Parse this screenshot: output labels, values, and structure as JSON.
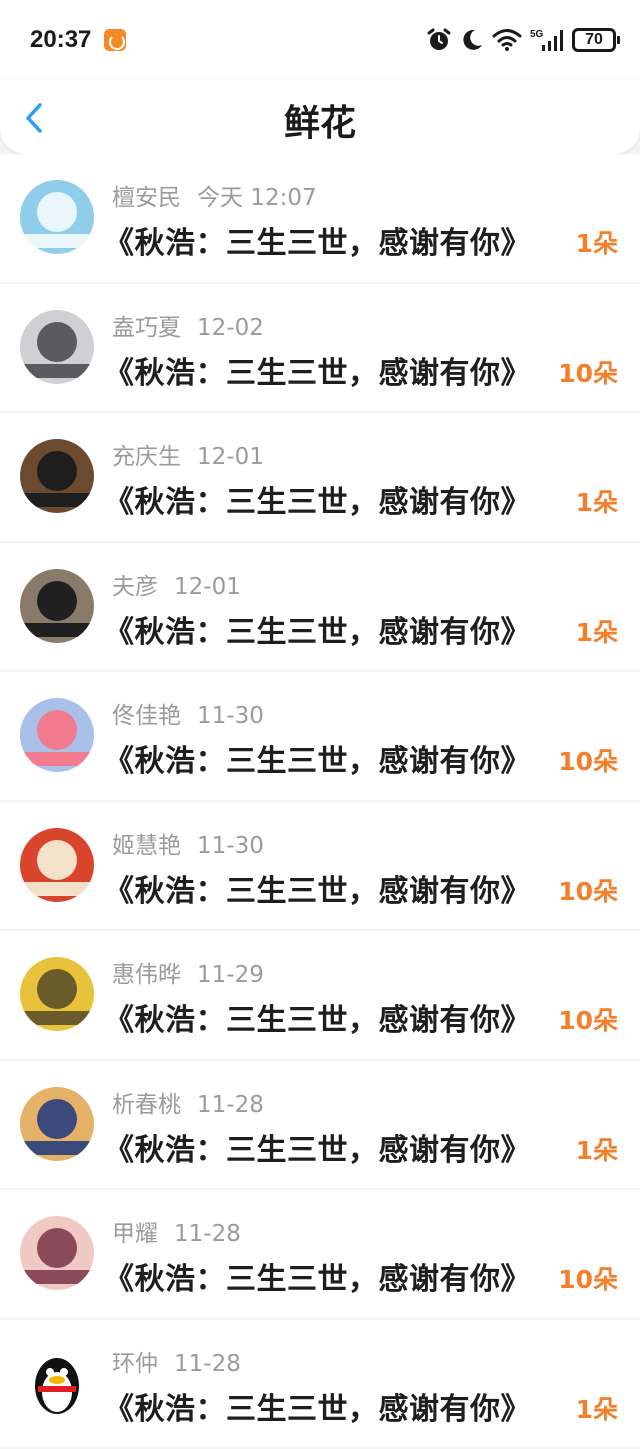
{
  "status_bar": {
    "time": "20:37",
    "network": "5G",
    "battery": "70",
    "icons": [
      "app-notification-icon",
      "alarm-icon",
      "moon-icon",
      "wifi-icon",
      "signal-icon",
      "battery-icon"
    ]
  },
  "header": {
    "title": "鲜花",
    "back_icon": "chevron-left-icon"
  },
  "colors": {
    "accent": "#2b9cf2",
    "count": "#f47e2a",
    "meta": "#9b9b9b",
    "title": "#1e1e1e"
  },
  "items": [
    {
      "name": "檀安民",
      "date": "今天 12:07",
      "title": "《秋浩：三生三世，感谢有你》",
      "count": "1朵",
      "avatar_bg": "#8fcdea",
      "avatar_fg": "#e9f6fc"
    },
    {
      "name": "盍巧夏",
      "date": "12-02",
      "title": "《秋浩：三生三世，感谢有你》",
      "count": "10朵",
      "avatar_bg": "#cfcfd4",
      "avatar_fg": "#5a5a5f"
    },
    {
      "name": "充庆生",
      "date": "12-01",
      "title": "《秋浩：三生三世，感谢有你》",
      "count": "1朵",
      "avatar_bg": "#6b4a2f",
      "avatar_fg": "#1e1e1e"
    },
    {
      "name": "夫彦",
      "date": "12-01",
      "title": "《秋浩：三生三世，感谢有你》",
      "count": "1朵",
      "avatar_bg": "#8a7a6a",
      "avatar_fg": "#202020"
    },
    {
      "name": "佟佳艳",
      "date": "11-30",
      "title": "《秋浩：三生三世，感谢有你》",
      "count": "10朵",
      "avatar_bg": "#a9c0e8",
      "avatar_fg": "#f27b8f"
    },
    {
      "name": "姬慧艳",
      "date": "11-30",
      "title": "《秋浩：三生三世，感谢有你》",
      "count": "10朵",
      "avatar_bg": "#d8452c",
      "avatar_fg": "#f3e2c9"
    },
    {
      "name": "惠伟晔",
      "date": "11-29",
      "title": "《秋浩：三生三世，感谢有你》",
      "count": "10朵",
      "avatar_bg": "#e8c23a",
      "avatar_fg": "#6b5a2a"
    },
    {
      "name": "析春桃",
      "date": "11-28",
      "title": "《秋浩：三生三世，感谢有你》",
      "count": "1朵",
      "avatar_bg": "#e6b267",
      "avatar_fg": "#3a4a7a"
    },
    {
      "name": "甲耀",
      "date": "11-28",
      "title": "《秋浩：三生三世，感谢有你》",
      "count": "10朵",
      "avatar_bg": "#f0c9c5",
      "avatar_fg": "#8a4a5a"
    },
    {
      "name": "环仲",
      "date": "11-28",
      "title": "《秋浩：三生三世，感谢有你》",
      "count": "1朵",
      "avatar_bg": "#ffffff",
      "avatar_fg": "#111111"
    }
  ]
}
